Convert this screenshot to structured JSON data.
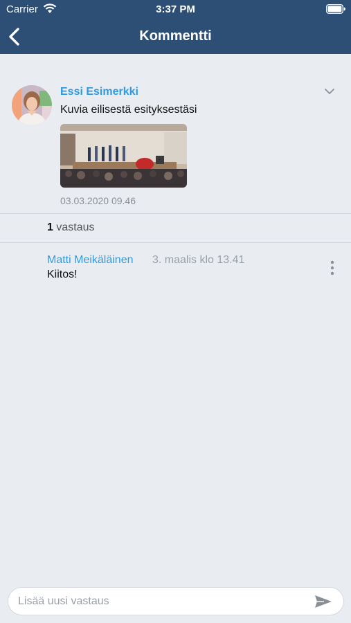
{
  "status_bar": {
    "carrier": "Carrier",
    "time": "3:37 PM"
  },
  "nav": {
    "title": "Kommentti"
  },
  "comment": {
    "author": "Essi Esimerkki",
    "text": "Kuvia eilisestä esityksestäsi",
    "date": "03.03.2020 09.46"
  },
  "replies_summary": {
    "count": "1",
    "label": "vastaus"
  },
  "reply": {
    "author": "Matti Meikäläinen",
    "time": "3. maalis klo 13.41",
    "text": "Kiitos!"
  },
  "composer": {
    "placeholder": "Lisää uusi vastaus",
    "value": ""
  },
  "colors": {
    "header": "#2d4f75",
    "accent": "#2f9ae0",
    "background": "#e9edf2"
  }
}
